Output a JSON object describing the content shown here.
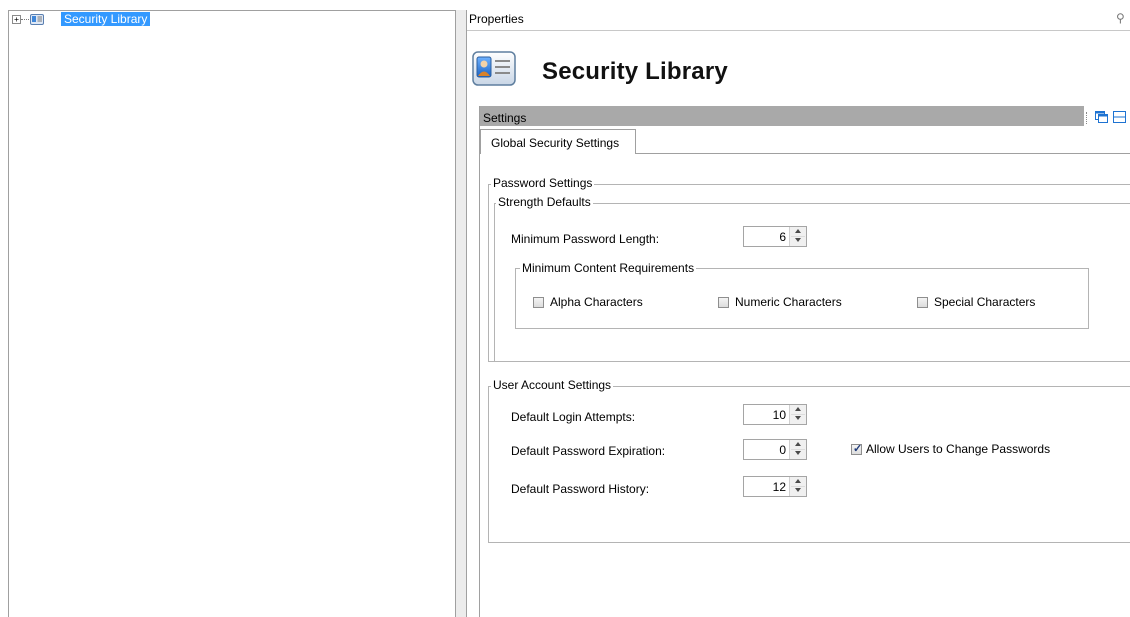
{
  "tree": {
    "expander": "+",
    "root_label": "Security Library"
  },
  "properties": {
    "header_title": "Properties",
    "search_icon": "magnifier-icon",
    "page_title": "Security Library",
    "settings_bar_label": "Settings",
    "tab_label": "Global Security Settings"
  },
  "password_settings": {
    "group_title": "Password Settings",
    "strength_group_title": "Strength Defaults",
    "min_length_label": "Minimum Password Length:",
    "min_length_value": "6",
    "content_group_title": "Minimum Content Requirements",
    "alpha_label": "Alpha Characters",
    "alpha_checked": false,
    "numeric_label": "Numeric Characters",
    "numeric_checked": false,
    "special_label": "Special Characters",
    "special_checked": false
  },
  "user_account_settings": {
    "group_title": "User Account Settings",
    "login_attempts_label": "Default Login Attempts:",
    "login_attempts_value": "10",
    "expiration_label": "Default Password Expiration:",
    "expiration_value": "0",
    "allow_change_label": "Allow Users to Change Passwords",
    "allow_change_checked": true,
    "history_label": "Default Password History:",
    "history_value": "12"
  },
  "colors": {
    "selection": "#3399ff",
    "settings_bar": "#a9a9a9",
    "accent_icon": "#1e73d2"
  }
}
